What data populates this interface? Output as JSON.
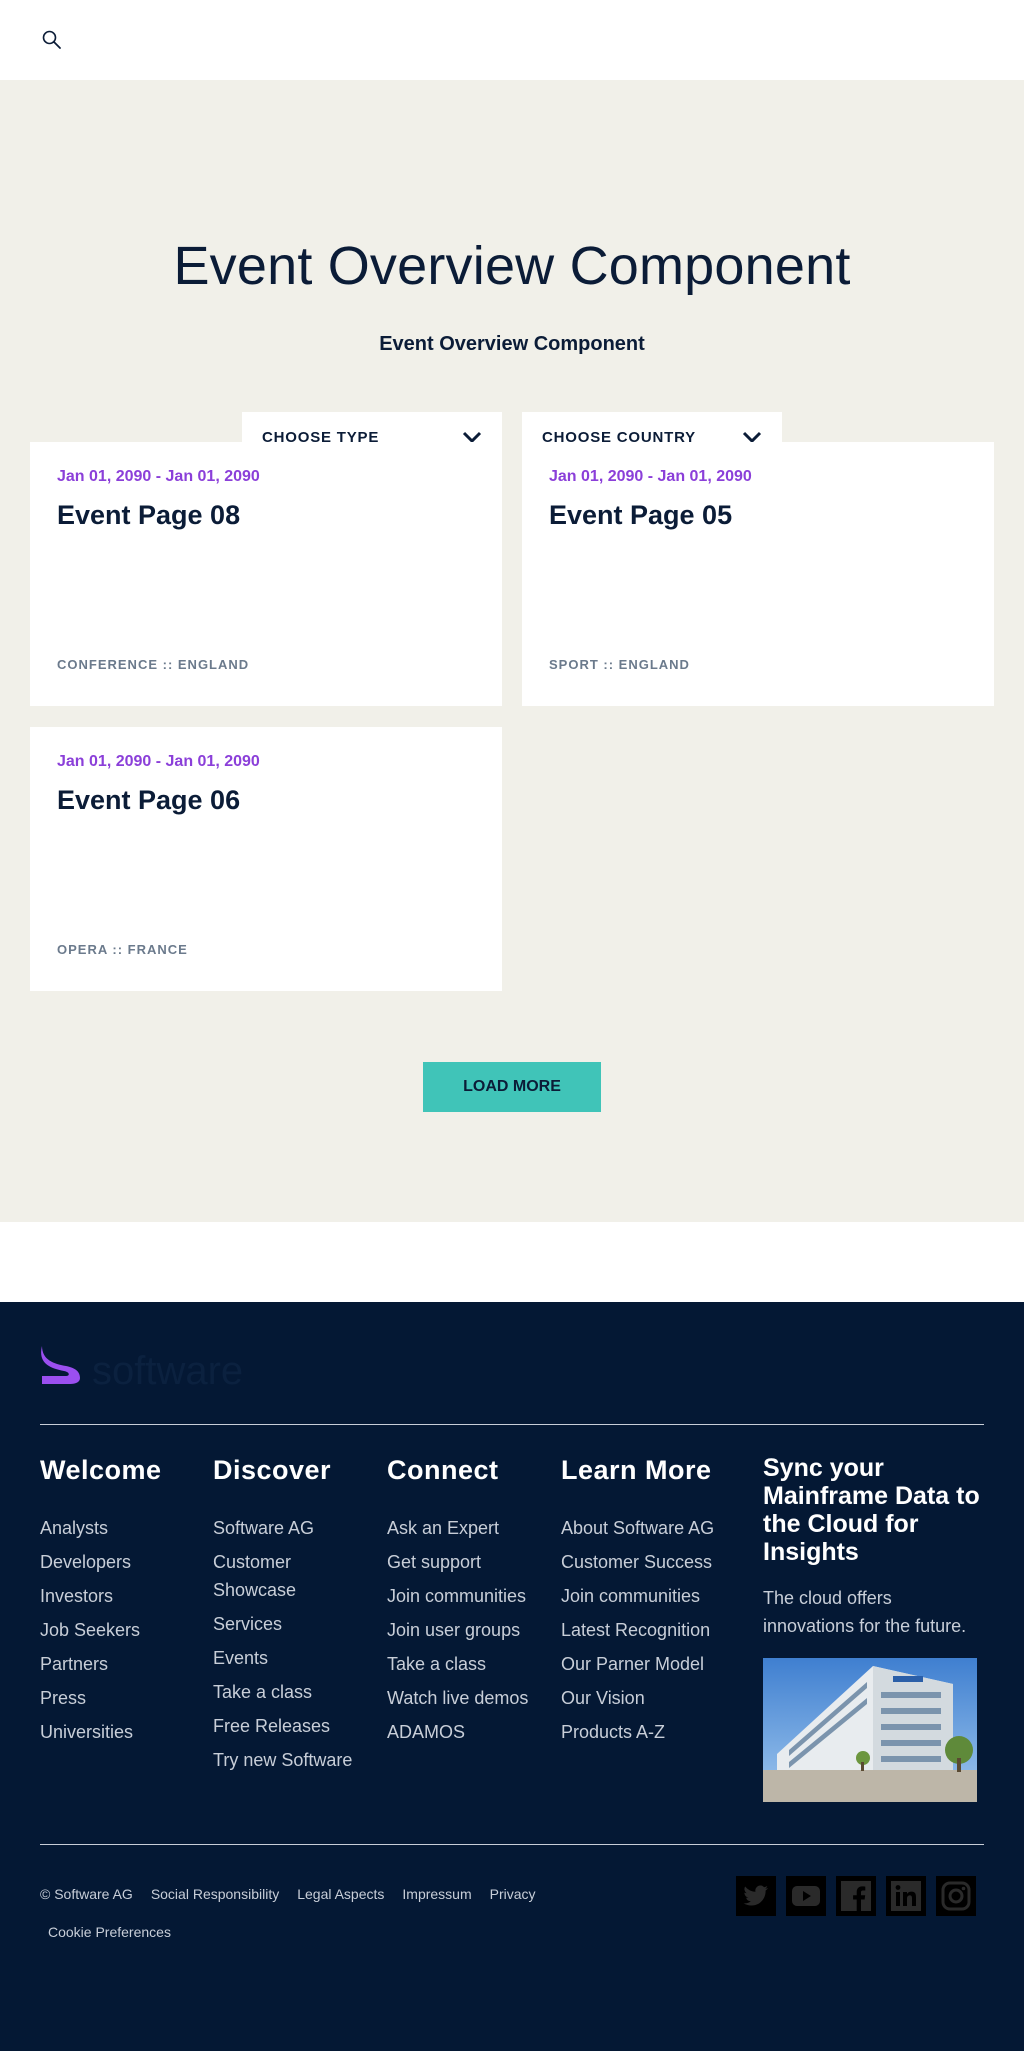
{
  "main": {
    "title": "Event Overview Component",
    "subtitle": "Event Overview Component",
    "filters": {
      "type_label": "CHOOSE TYPE",
      "country_label": "CHOOSE COUNTRY"
    },
    "events": [
      {
        "date": "Jan 01, 2090 - Jan 01, 2090",
        "title": "Event Page 08",
        "meta": "CONFERENCE :: ENGLAND"
      },
      {
        "date": "Jan 01, 2090 - Jan 01, 2090",
        "title": "Event Page 05",
        "meta": "SPORT :: ENGLAND"
      },
      {
        "date": "Jan 01, 2090 - Jan 01, 2090",
        "title": "Event Page 06",
        "meta": "OPERA :: FRANCE"
      }
    ],
    "load_more_label": "LOAD MORE"
  },
  "footer": {
    "logo_text": "software",
    "columns": [
      {
        "heading": "Welcome",
        "links": [
          "Analysts",
          "Developers",
          "Investors",
          "Job Seekers",
          "Partners",
          "Press",
          "Universities"
        ]
      },
      {
        "heading": "Discover",
        "links": [
          "Software AG",
          "Customer Showcase",
          "Services",
          "Events",
          "Take a class",
          "Free Releases",
          "Try new Software"
        ]
      },
      {
        "heading": "Connect",
        "links": [
          "Ask an Expert",
          "Get support",
          "Join communities",
          "Join user groups",
          "Take a class",
          "Watch live demos",
          "ADAMOS"
        ]
      },
      {
        "heading": "Learn More",
        "links": [
          "About Software AG",
          "Customer Success",
          "Join communities",
          "Latest Recognition",
          "Our Parner Model",
          "Our Vision",
          "Products A-Z"
        ]
      }
    ],
    "promo": {
      "title": "Sync your Mainframe Data to the Cloud for Insights",
      "text": "The cloud offers innovations for the future."
    },
    "legal": {
      "copyright": "© Software AG",
      "social_responsibility": "Social Responsibility",
      "legal_aspects": "Legal Aspects",
      "impressum": "Impressum",
      "privacy": "Privacy",
      "cookie": "Cookie Preferences"
    },
    "social_icons": [
      "twitter-icon",
      "youtube-icon",
      "facebook-icon",
      "linkedin-icon",
      "instagram-icon"
    ]
  },
  "colors": {
    "navy": "#0b1c37",
    "footer_bg": "#041834",
    "page_bg": "#f1f0e9",
    "accent_purple": "#8b3fd9",
    "button_teal": "#40c4b8"
  }
}
